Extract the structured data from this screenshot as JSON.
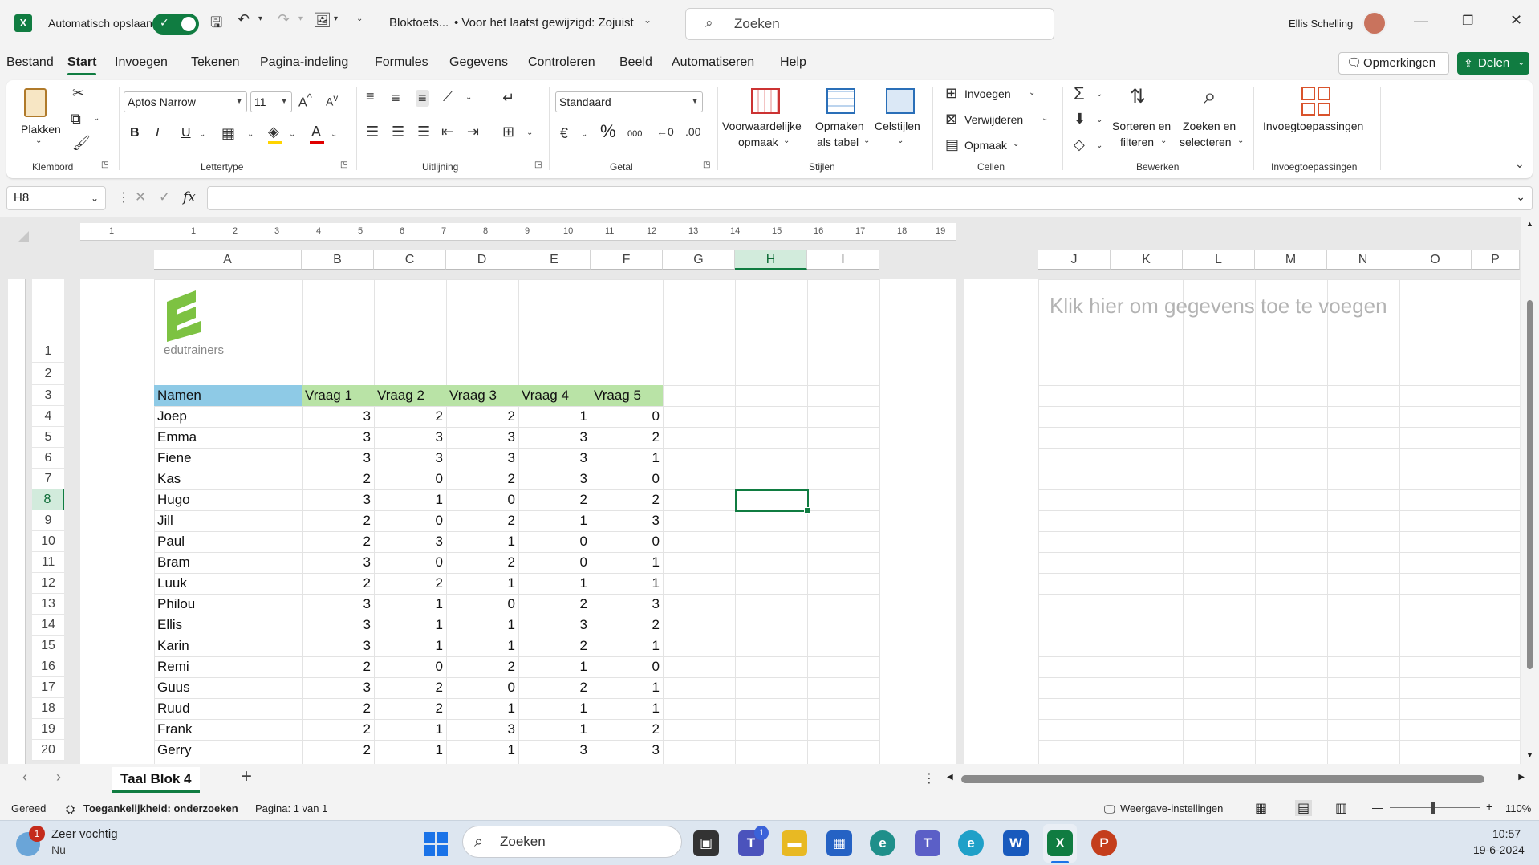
{
  "titlebar": {
    "autosave_label": "Automatisch opslaan",
    "doc_title": "Bloktoets...",
    "saved_status": "• Voor het laatst gewijzigd: Zojuist",
    "search_placeholder": "Zoeken",
    "user_name": "Ellis Schelling"
  },
  "tabs": [
    "Bestand",
    "Start",
    "Invoegen",
    "Tekenen",
    "Pagina-indeling",
    "Formules",
    "Gegevens",
    "Controleren",
    "Beeld",
    "Automatiseren",
    "Help"
  ],
  "actions": {
    "comments": "Opmerkingen",
    "share": "Delen"
  },
  "ribbon": {
    "groups": {
      "clipboard": "Klembord",
      "font": "Lettertype",
      "alignment": "Uitlijning",
      "number": "Getal",
      "styles": "Stijlen",
      "cells": "Cellen",
      "editing": "Bewerken",
      "addins": "Invoegtoepassingen"
    },
    "paste": "Plakken",
    "font_name": "Aptos Narrow",
    "font_size": "11",
    "number_format": "Standaard",
    "bold": "B",
    "italic": "I",
    "underline": "U",
    "percent": "%",
    "thousands": "000",
    "cond_format_1": "Voorwaardelijke",
    "cond_format_2": "opmaak",
    "format_table_1": "Opmaken",
    "format_table_2": "als tabel",
    "cell_styles": "Celstijlen",
    "insert": "Invoegen",
    "delete": "Verwijderen",
    "format": "Opmaak",
    "sort_1": "Sorteren en",
    "sort_2": "filteren",
    "find_1": "Zoeken en",
    "find_2": "selecteren",
    "addins_btn": "Invoegtoepassingen"
  },
  "formula_bar": {
    "name_box": "H8",
    "fx": "fx",
    "value": ""
  },
  "ruler": [
    "1",
    "1",
    "2",
    "3",
    "4",
    "5",
    "6",
    "7",
    "8",
    "9",
    "10",
    "11",
    "12",
    "13",
    "14",
    "15",
    "16",
    "17",
    "18",
    "19"
  ],
  "columns_left": [
    "A",
    "B",
    "C",
    "D",
    "E",
    "F",
    "G",
    "H",
    "I"
  ],
  "columns_right": [
    "J",
    "K",
    "L",
    "M",
    "N",
    "O",
    "P"
  ],
  "logo_text": "edutrainers",
  "header_row": [
    "Namen",
    "Vraag 1",
    "Vraag 2",
    "Vraag 3",
    "Vraag 4",
    "Vraag 5"
  ],
  "rows": [
    [
      "Joep",
      3,
      2,
      2,
      1,
      0
    ],
    [
      "Emma",
      3,
      3,
      3,
      3,
      2
    ],
    [
      "Fiene",
      3,
      3,
      3,
      3,
      1
    ],
    [
      "Kas",
      2,
      0,
      2,
      3,
      0
    ],
    [
      "Hugo",
      3,
      1,
      0,
      2,
      2
    ],
    [
      "Jill",
      2,
      0,
      2,
      1,
      3
    ],
    [
      "Paul",
      2,
      3,
      1,
      0,
      0
    ],
    [
      "Bram",
      3,
      0,
      2,
      0,
      1
    ],
    [
      "Luuk",
      2,
      2,
      1,
      1,
      1
    ],
    [
      "Philou",
      3,
      1,
      0,
      2,
      3
    ],
    [
      "Ellis",
      3,
      1,
      1,
      3,
      2
    ],
    [
      "Karin",
      3,
      1,
      1,
      2,
      1
    ],
    [
      "Remi",
      2,
      0,
      2,
      1,
      0
    ],
    [
      "Guus",
      3,
      2,
      0,
      2,
      1
    ],
    [
      "Ruud",
      2,
      2,
      1,
      1,
      1
    ],
    [
      "Frank",
      2,
      1,
      3,
      1,
      2
    ],
    [
      "Gerry",
      2,
      1,
      1,
      3,
      3
    ]
  ],
  "row_numbers": [
    "1",
    "2",
    "3",
    "4",
    "5",
    "6",
    "7",
    "8",
    "9",
    "10",
    "11",
    "12",
    "13",
    "14",
    "15",
    "16",
    "17",
    "18",
    "19",
    "20"
  ],
  "placeholder_text": "Klik hier om gegevens toe te voegen",
  "sheet_tab": "Taal Blok 4",
  "status": {
    "ready": "Gereed",
    "accessibility": "Toegankelijkheid: onderzoeken",
    "page": "Pagina: 1 van 1",
    "display_settings": "Weergave-instellingen",
    "zoom": "110%"
  },
  "taskbar": {
    "weather_title": "Zeer vochtig",
    "weather_sub": "Nu",
    "weather_badge": "1",
    "search": "Zoeken",
    "teams_badge": "1",
    "time": "10:57",
    "date": "19-6-2024"
  },
  "colors": {
    "accent": "#107c41",
    "header_blue": "#8ecae6",
    "header_green": "#b9e3a6"
  }
}
